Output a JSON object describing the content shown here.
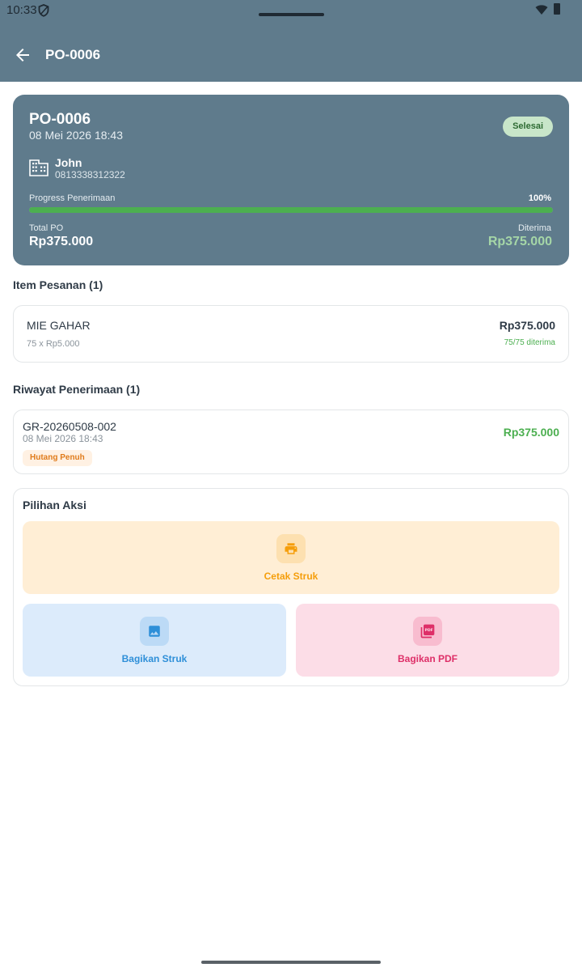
{
  "status_bar": {
    "time": "10:33",
    "shield_icon": "shield-icon",
    "wifi_icon": "wifi-icon",
    "battery_icon": "battery-icon"
  },
  "app_bar": {
    "back_icon": "arrow-left-icon",
    "title": "PO-0006"
  },
  "po_card": {
    "number": "PO-0006",
    "date": "08 Mei 2026 18:43",
    "status": "Selesai",
    "supplier_icon": "building-icon",
    "supplier_name": "John",
    "supplier_phone": "0813338312322",
    "progress_label": "Progress Penerimaan",
    "progress_pct": "100%",
    "progress_value": 1.0,
    "total_label": "Total PO",
    "total_value": "Rp375.000",
    "received_label": "Diterima",
    "received_value": "Rp375.000"
  },
  "items_section": {
    "title": "Item Pesanan (1)",
    "items": [
      {
        "name": "MIE GAHAR",
        "qty": "75 x Rp5.000",
        "total": "Rp375.000",
        "received": "75/75 diterima"
      }
    ]
  },
  "history_section": {
    "title": "Riwayat Penerimaan (1)",
    "entries": [
      {
        "number": "GR-20260508-002",
        "date": "08 Mei 2026 18:43",
        "badge": "Hutang Penuh",
        "amount": "Rp375.000"
      }
    ]
  },
  "actions": {
    "title": "Pilihan Aksi",
    "print": {
      "label": "Cetak Struk",
      "icon": "printer-icon"
    },
    "share_image": {
      "label": "Bagikan Struk",
      "icon": "image-icon"
    },
    "share_pdf": {
      "label": "Bagikan PDF",
      "icon": "pdf-icon"
    }
  },
  "colors": {
    "primary": "#5f7b8c",
    "success": "#4caf50",
    "print_bg": "#ffeed5",
    "print_fg": "#f59e0b",
    "image_bg": "#dcebfb",
    "image_fg": "#2e8fd8",
    "pdf_bg": "#fcdde7",
    "pdf_fg": "#de2f68"
  }
}
